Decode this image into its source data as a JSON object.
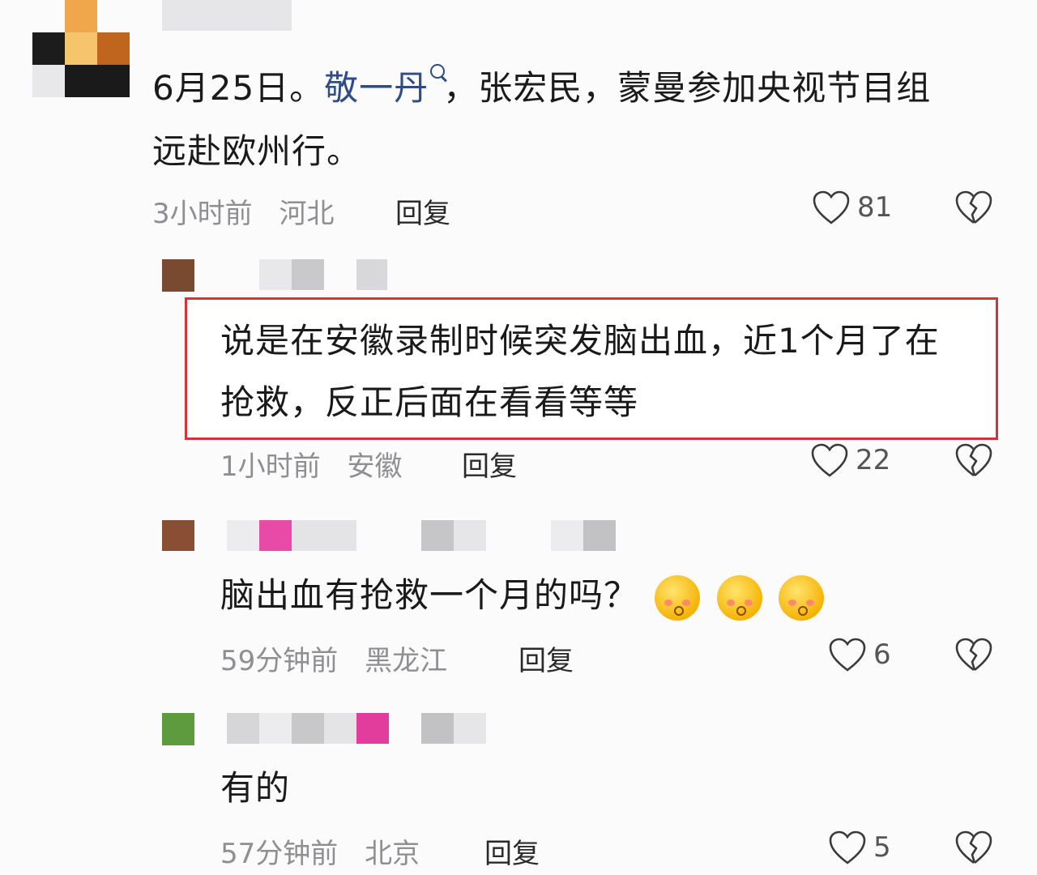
{
  "comments": [
    {
      "text_before_link": "6月25日。",
      "link_text": "敬一丹",
      "text_after_link": "，张宏民，蒙曼参加央视节目组",
      "text_line2": "远赴欧州行。",
      "time": "3小时前",
      "location": "河北",
      "reply_label": "回复",
      "likes": "81"
    },
    {
      "text_line1": "说是在安徽录制时候突发脑出血，近1个月了在",
      "text_line2": "抢救，反正后面在看看等等",
      "time": "1小时前",
      "location": "安徽",
      "reply_label": "回复",
      "likes": "22"
    },
    {
      "text": "脑出血有抢救一个月的吗？",
      "time": "59分钟前",
      "location": "黑龙江",
      "reply_label": "回复",
      "likes": "6"
    },
    {
      "text": "有的",
      "time": "57分钟前",
      "location": "北京",
      "reply_label": "回复",
      "likes": "5"
    }
  ],
  "colors": {
    "highlight_border": "#d2343a",
    "topic_link": "#2f4c87",
    "meta_text": "#8e8e93"
  },
  "icons": [
    "heart-icon",
    "broken-heart-icon",
    "search-icon",
    "emoji-icon"
  ]
}
